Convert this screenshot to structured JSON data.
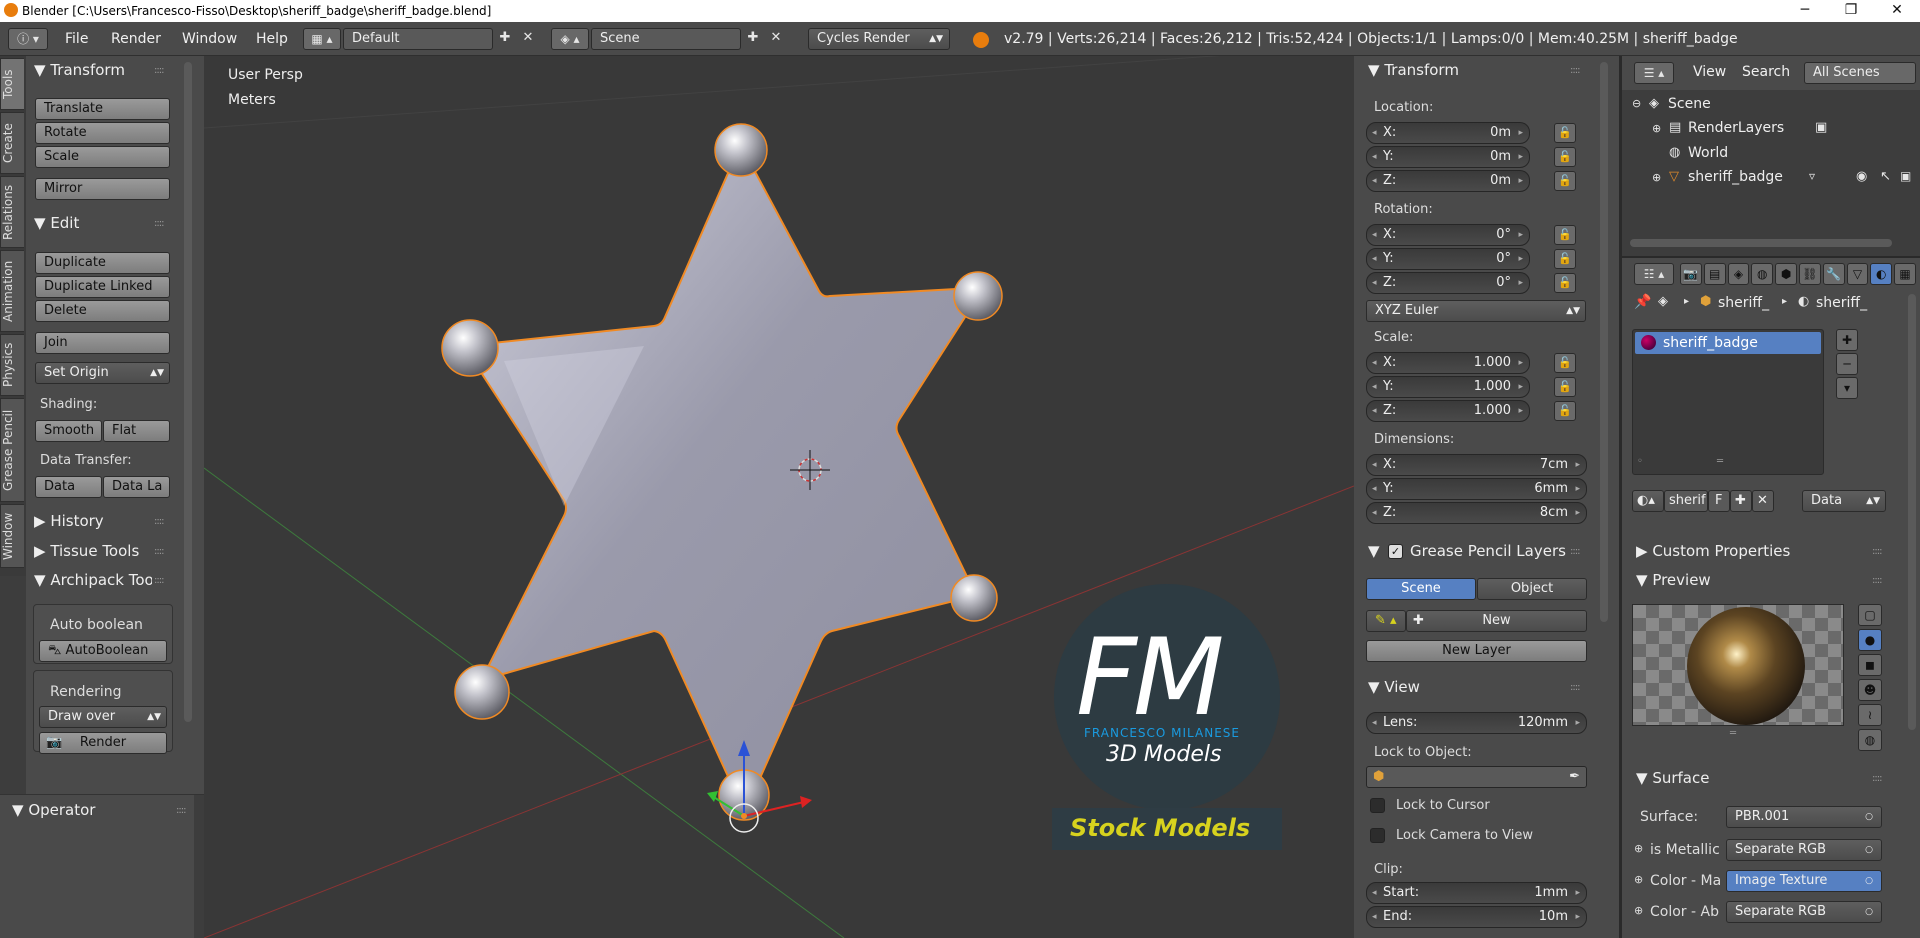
{
  "window": {
    "title": "Blender [C:\\Users\\Francesco-Fisso\\Desktop\\sheriff_badge\\sheriff_badge.blend]"
  },
  "menu": {
    "file": "File",
    "render": "Render",
    "window": "Window",
    "help": "Help"
  },
  "screen_layout": "Default",
  "scene_name": "Scene",
  "render_engine": "Cycles Render",
  "stats": "v2.79 | Verts:26,214 | Faces:26,212 | Tris:52,424 | Objects:1/1 | Lamps:0/0 | Mem:40.25M | sheriff_badge",
  "tool_tabs": [
    "Tools",
    "Create",
    "Relations",
    "Animation",
    "Physics",
    "Grease Pencil",
    "Window"
  ],
  "toolshelf": {
    "transform_title": "Transform",
    "translate": "Translate",
    "rotate": "Rotate",
    "scale": "Scale",
    "mirror": "Mirror",
    "edit_title": "Edit",
    "duplicate": "Duplicate",
    "duplicate_linked": "Duplicate Linked",
    "delete": "Delete",
    "join": "Join",
    "set_origin": "Set Origin",
    "shading_label": "Shading:",
    "smooth": "Smooth",
    "flat": "Flat",
    "data_transfer_label": "Data Transfer:",
    "data": "Data",
    "data_la": "Data La",
    "history": "History",
    "tissue_tools": "Tissue Tools",
    "archipack": "Archipack Tools",
    "auto_boolean_label": "Auto boolean",
    "auto_boolean": "AutoBoolean",
    "rendering_label": "Rendering",
    "draw_over": "Draw over",
    "render_btn": "Render",
    "operator": "Operator"
  },
  "viewport": {
    "view_name": "User Persp",
    "units": "Meters"
  },
  "watermark": {
    "letters": "FM",
    "name": "FRANCESCO MILANESE",
    "sub": "3D Models",
    "stock": "Stock Models"
  },
  "properties": {
    "transform_title": "Transform",
    "location_label": "Location:",
    "loc": [
      {
        "k": "X:",
        "v": "0m"
      },
      {
        "k": "Y:",
        "v": "0m"
      },
      {
        "k": "Z:",
        "v": "0m"
      }
    ],
    "rotation_label": "Rotation:",
    "rot": [
      {
        "k": "X:",
        "v": "0°"
      },
      {
        "k": "Y:",
        "v": "0°"
      },
      {
        "k": "Z:",
        "v": "0°"
      }
    ],
    "rotation_mode": "XYZ Euler",
    "scale_label": "Scale:",
    "scl": [
      {
        "k": "X:",
        "v": "1.000"
      },
      {
        "k": "Y:",
        "v": "1.000"
      },
      {
        "k": "Z:",
        "v": "1.000"
      }
    ],
    "dimensions_label": "Dimensions:",
    "dim": [
      {
        "k": "X:",
        "v": "7cm"
      },
      {
        "k": "Y:",
        "v": "6mm"
      },
      {
        "k": "Z:",
        "v": "8cm"
      }
    ],
    "gp_title": "Grease Pencil Layers",
    "gp_scene": "Scene",
    "gp_object": "Object",
    "gp_new": "New",
    "gp_new_layer": "New Layer",
    "view_title": "View",
    "lens_label": "Lens:",
    "lens_value": "120mm",
    "lock_to_object": "Lock to Object:",
    "lock_to_cursor": "Lock to Cursor",
    "lock_camera": "Lock Camera to View",
    "clip_label": "Clip:",
    "clip_start_label": "Start:",
    "clip_start": "1mm",
    "clip_end_label": "End:",
    "clip_end": "10m"
  },
  "outliner": {
    "view": "View",
    "search": "Search",
    "all_scenes": "All Scenes",
    "scene": "Scene",
    "render_layers": "RenderLayers",
    "world": "World",
    "object": "sheriff_badge"
  },
  "material": {
    "breadcrumb_obj": "sheriff_",
    "breadcrumb_mat": "sheriff_",
    "slot": "sheriff_badge",
    "mat_field": "sherif",
    "f_label": "F",
    "link": "Data",
    "custom_props": "Custom Properties",
    "preview": "Preview",
    "surface_title": "Surface",
    "surface_label": "Surface:",
    "surface_value": "PBR.001",
    "inputs": [
      {
        "k": "is Metallic",
        "v": "Separate RGB"
      },
      {
        "k": "Color - Ma",
        "v": "Image Texture"
      },
      {
        "k": "Color - Ab",
        "v": "Separate RGB"
      }
    ]
  },
  "colors": {
    "selection": "#5680c2",
    "object_outline": "#f08a24",
    "accent_blue": "#1a9be0"
  }
}
